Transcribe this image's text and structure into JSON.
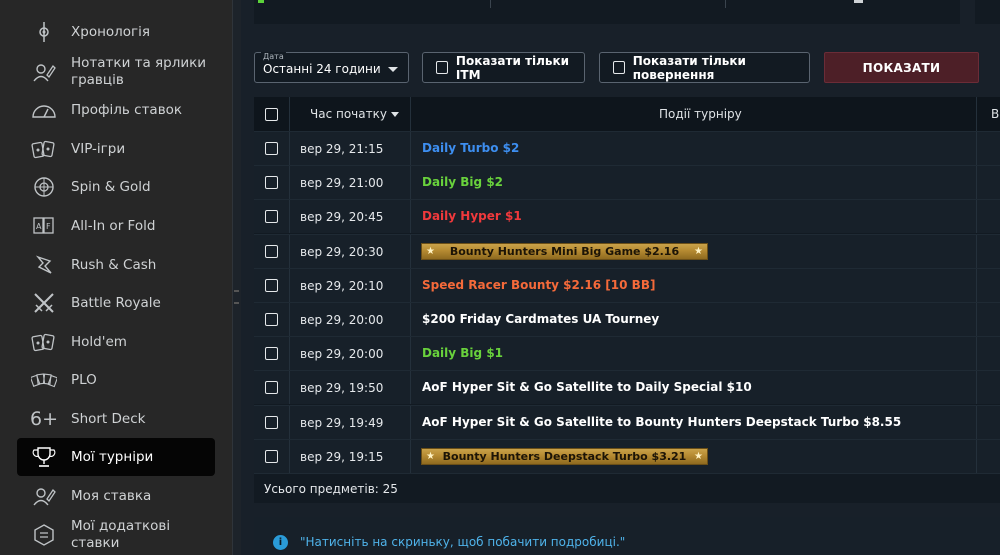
{
  "sidebar": {
    "items": [
      {
        "label": "Хронологія",
        "icon": "history-icon"
      },
      {
        "label": "Нотатки та ярлики гравців",
        "icon": "notes-icon"
      },
      {
        "label": "Профіль ставок",
        "icon": "gauge-icon"
      },
      {
        "label": "VIP-ігри",
        "icon": "cards-icon"
      },
      {
        "label": "Spin & Gold",
        "icon": "spin-wheel-icon"
      },
      {
        "label": "All-In or Fold",
        "icon": "allin-fold-icon"
      },
      {
        "label": "Rush & Cash",
        "icon": "rush-icon"
      },
      {
        "label": "Battle Royale",
        "icon": "crossed-swords-icon"
      },
      {
        "label": "Hold'em",
        "icon": "holdem-cards-icon"
      },
      {
        "label": "PLO",
        "icon": "plo-cards-icon"
      },
      {
        "label": "Short Deck",
        "icon": "six-plus-icon"
      },
      {
        "label": "Мої турніри",
        "icon": "trophy-icon",
        "active": true
      },
      {
        "label": "Моя ставка",
        "icon": "bet-icon"
      },
      {
        "label": "Мої додаткові ставки",
        "icon": "extra-bet-icon"
      }
    ]
  },
  "filters": {
    "date_caption": "Дата",
    "date_value": "Останні 24 години",
    "itm_only": "Показати тільки ITM",
    "returns_only": "Показати тільки повернення",
    "show_button": "ПОКАЗАТИ"
  },
  "table": {
    "col_time": "Час початку",
    "col_events": "Події турніру",
    "col_extra": "В",
    "rows": [
      {
        "time": "вер 29, 21:15",
        "event": "Daily Turbo $2",
        "color": "#3d8ef0",
        "banner": false
      },
      {
        "time": "вер 29, 21:00",
        "event": "Daily Big $2",
        "color": "#69d23c",
        "banner": false
      },
      {
        "time": "вер 29, 20:45",
        "event": "Daily Hyper $1",
        "color": "#f0393c",
        "banner": false
      },
      {
        "time": "вер 29, 20:30",
        "event": "Bounty Hunters Mini Big Game $2.16",
        "color": "#1c1406",
        "banner": true
      },
      {
        "time": "вер 29, 20:10",
        "event": "Speed Racer Bounty $2.16 [10 BB]",
        "color": "#f56a3a",
        "banner": false
      },
      {
        "time": "вер 29, 20:00",
        "event": "$200 Friday Cardmates UA Tourney",
        "color": "#ffffff",
        "banner": false
      },
      {
        "time": "вер 29, 20:00",
        "event": "Daily Big $1",
        "color": "#69d23c",
        "banner": false
      },
      {
        "time": "вер 29, 19:50",
        "event": "AoF Hyper Sit & Go Satellite to Daily Special $10",
        "color": "#ffffff",
        "banner": false
      },
      {
        "time": "вер 29, 19:49",
        "event": "AoF Hyper Sit & Go Satellite to Bounty Hunters Deepstack Turbo $8.55",
        "color": "#ffffff",
        "banner": false
      },
      {
        "time": "вер 29, 19:15",
        "event": "Bounty Hunters Deepstack Turbo $3.21",
        "color": "#1c1406",
        "banner": true
      }
    ],
    "footer": "Усього предметів: 25"
  },
  "info": {
    "text": "\"Натисніть на скриньку, щоб побачити подробиці.\""
  }
}
